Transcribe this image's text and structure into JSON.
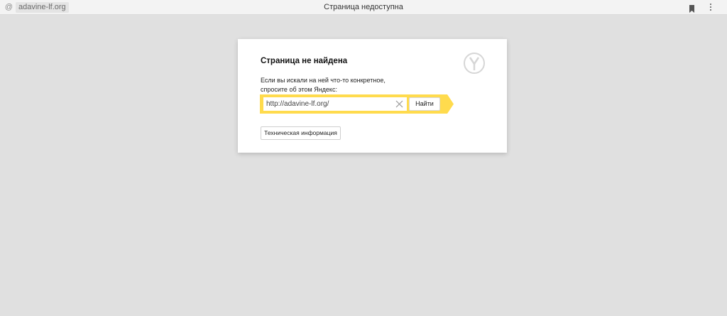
{
  "browser": {
    "address": "adavine-lf.org",
    "tab_title": "Страница недоступна",
    "icons": {
      "site": "at-icon",
      "bookmark": "bookmark-icon",
      "menu": "kebab-menu-icon"
    }
  },
  "error_card": {
    "title": "Страница не найдена",
    "description_line1": "Если вы искали на ней что-то конкретное,",
    "description_line2": "спросите об этом Яндекс:",
    "search_value": "http://adavine-lf.org/",
    "search_button_label": "Найти",
    "tech_info_label": "Техническая информация",
    "logo_icon": "yandex-browser-logo-icon"
  },
  "colors": {
    "background": "#e0e0e0",
    "accent_yellow": "#ffdb4d",
    "card": "#ffffff"
  }
}
